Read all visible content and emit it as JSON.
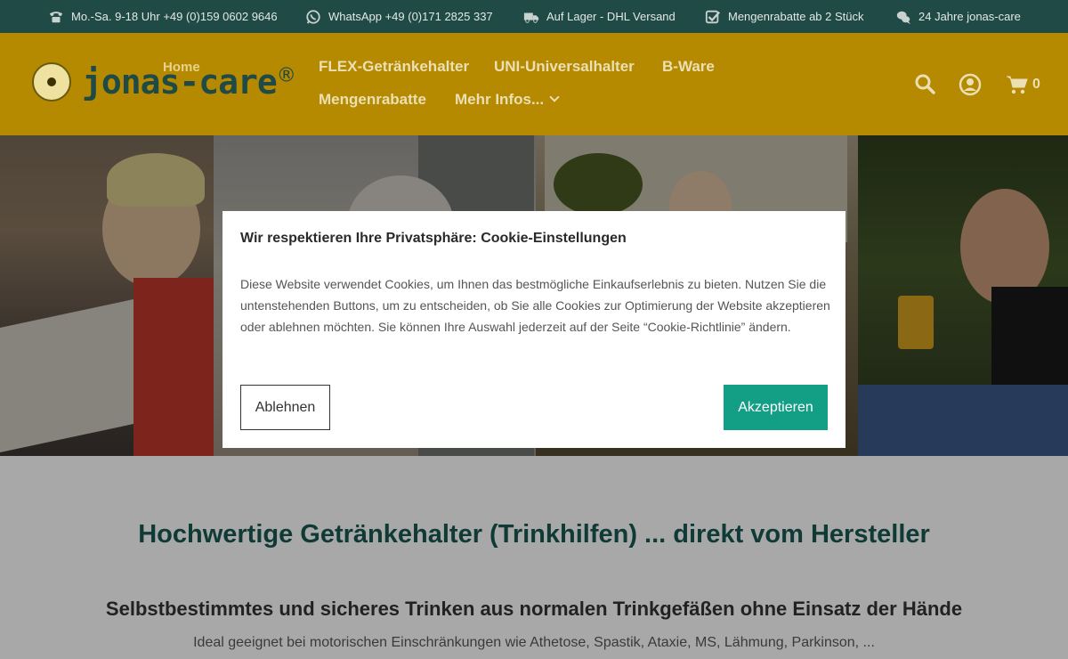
{
  "topbar": {
    "items": [
      {
        "icon": "phone-icon",
        "text": "Mo.-Sa. 9-18 Uhr +49 (0)159 0602 9646"
      },
      {
        "icon": "whatsapp-icon",
        "text": "WhatsApp +49 (0)171 2825 337"
      },
      {
        "icon": "truck-icon",
        "text": "Auf Lager - DHL Versand"
      },
      {
        "icon": "checkbox-icon",
        "text": "Mengenrabatte ab 2 Stück"
      },
      {
        "icon": "chat-icon",
        "text": "24 Jahre jonas-care"
      }
    ]
  },
  "header": {
    "logo_text": "jonas-care",
    "logo_reg": "®",
    "home_label": "Home",
    "nav": [
      {
        "label": "FLEX-Getränkehalter"
      },
      {
        "label": "UNI-Universalhalter"
      },
      {
        "label": "B-Ware"
      },
      {
        "label": "Mengenrabatte"
      },
      {
        "label": "Mehr Infos..."
      }
    ],
    "cart_count": "0"
  },
  "cookie": {
    "title": "Wir respektieren Ihre Privatsphäre: Cookie-Einstellungen",
    "text": "Diese Website verwendet Cookies, um Ihnen das bestmögliche Einkaufserlebnis zu bieten. Nutzen Sie die untenstehenden Buttons, um zu entscheiden, ob Sie alle Cookies zur Optimierung der Website akzeptieren oder ablehnen möchten. Sie können Ihre Auswahl jederzeit auf der Seite “Cookie-Richtlinie” ändern.",
    "decline_label": "Ablehnen",
    "accept_label": "Akzeptieren"
  },
  "content": {
    "headline": "Hochwertige Getränkehalter (Trinkhilfen) ... direkt vom Hersteller",
    "subheadline": "Selbstbestimmtes und sicheres Trinken aus normalen Trinkgefäßen ohne Einsatz der Hände",
    "description": "Ideal geeignet bei motorischen Einschränkungen wie Athetose, Spastik, Ataxie, MS, Lähmung, Parkinson, ..."
  },
  "colors": {
    "topbar_bg": "#1f4a45",
    "header_bg": "#b58a00",
    "accent": "#139e86",
    "headline": "#0f3a35"
  }
}
